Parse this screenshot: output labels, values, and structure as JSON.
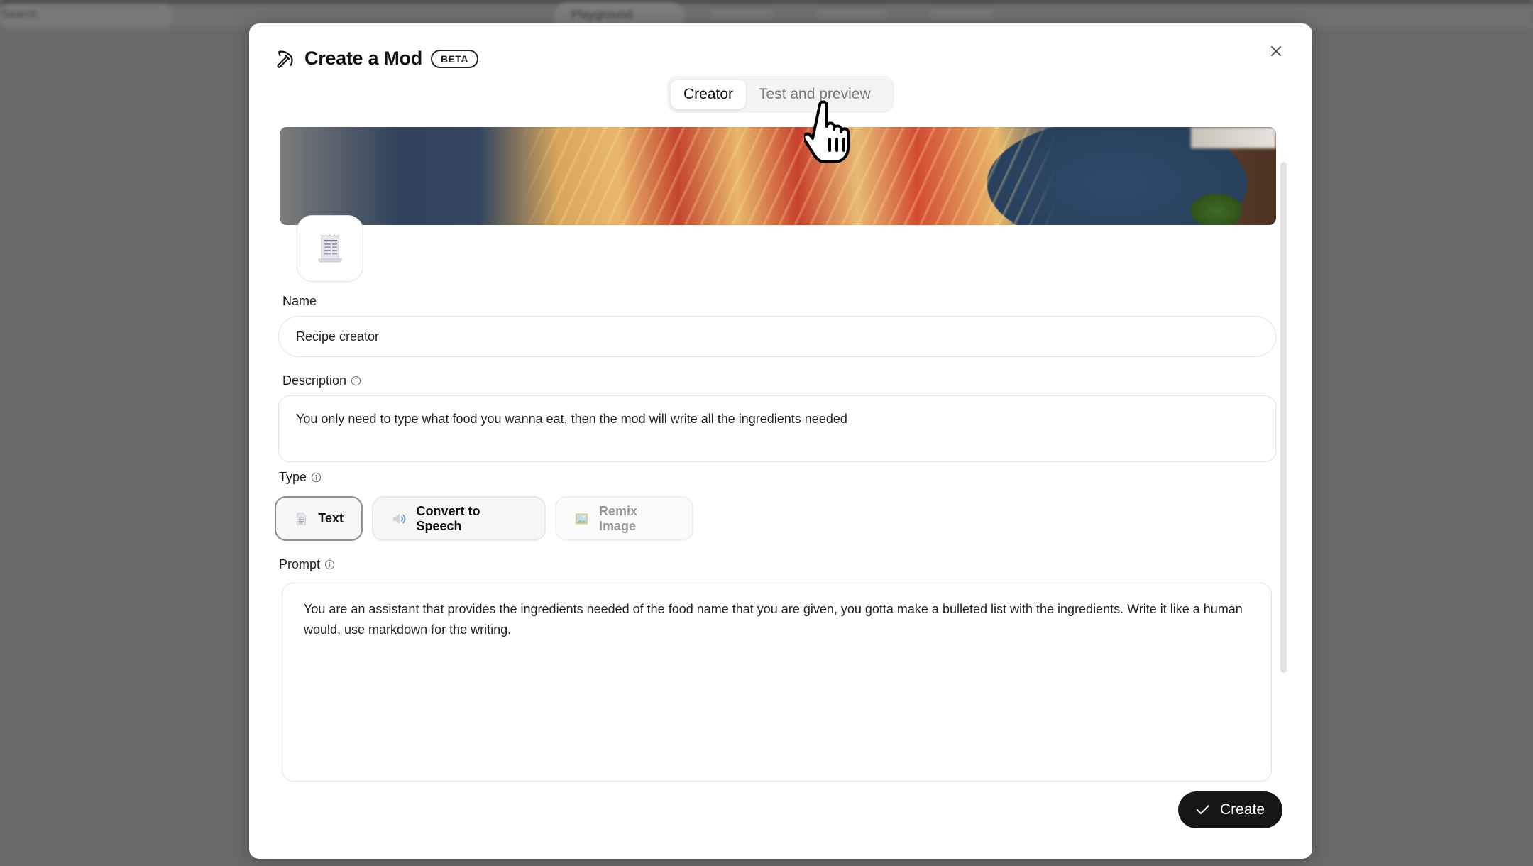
{
  "background": {
    "search_text": "Search",
    "active_nav_label": "Playground"
  },
  "modal": {
    "title": "Create a Mod",
    "badge": "BETA",
    "tabs": [
      {
        "label": "Creator",
        "active": true
      },
      {
        "label": "Test and preview",
        "active": false
      }
    ],
    "form": {
      "name_label": "Name",
      "name_value": "Recipe creator",
      "description_label": "Description",
      "description_value": "You only need to type what food you wanna eat, then the mod will write all the ingredients needed",
      "type_label": "Type",
      "type_options": [
        {
          "label": "Text",
          "icon": "document-icon",
          "state": "selected"
        },
        {
          "label": "Convert to Speech",
          "icon": "speaker-icon",
          "state": "default"
        },
        {
          "label": "Remix Image",
          "icon": "image-icon",
          "state": "disabled"
        }
      ],
      "prompt_label": "Prompt",
      "prompt_value": "You are an assistant that provides the ingredients needed of the food name that you are given, you gotta make a bulleted list with the ingredients. Write it like a human would, use markdown for the writing."
    },
    "create_label": "Create"
  }
}
